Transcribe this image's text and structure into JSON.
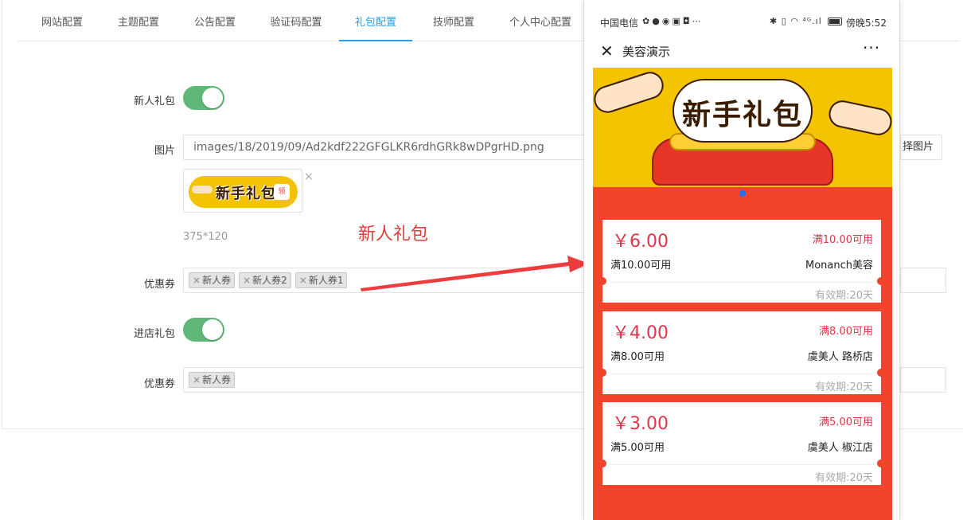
{
  "tabs": [
    "网站配置",
    "主题配置",
    "公告配置",
    "验证码配置",
    "礼包配置",
    "技师配置",
    "个人中心配置"
  ],
  "form": {
    "newbie_label": "新人礼包",
    "image_label": "图片",
    "image_path": "images/18/2019/09/Ad2kdf222GFGLKR6rdhGRk8wDPgrHD.png",
    "pick_image_label": "择图片",
    "thumb_text": "新手礼包",
    "thumb_btn": "领",
    "size_hint": "375*120",
    "annotation": "新人礼包",
    "coupon_label_1": "优惠券",
    "coupons_1": [
      "新人券",
      "新人券2",
      "新人券1"
    ],
    "store_label": "进店礼包",
    "coupon_label_2": "优惠券",
    "coupons_2": [
      "新人券"
    ],
    "tag_remove": "×",
    "thumb_close": "×"
  },
  "phone": {
    "carrier": "中国电信",
    "signal_text": "⁴ᴳ.ıl",
    "time": "傍晚5:52",
    "close": "✕",
    "title": "美容演示",
    "more": "···",
    "banner_title": "新手礼包"
  },
  "coupons": [
    {
      "amount": "￥6.00",
      "cond_right": "满10.00可用",
      "cond_left": "满10.00可用",
      "shop": "Monanch美容",
      "valid": "有效期:20天"
    },
    {
      "amount": "￥4.00",
      "cond_right": "满8.00可用",
      "cond_left": "满8.00可用",
      "shop": "虞美人 路桥店",
      "valid": "有效期:20天"
    },
    {
      "amount": "￥3.00",
      "cond_right": "满5.00可用",
      "cond_left": "满5.00可用",
      "shop": "虞美人 椒江店",
      "valid": "有效期:20天"
    }
  ],
  "colors": {
    "accent": "#1e9fff",
    "switch_on": "#5fb878",
    "coupon_red": "#e0364a",
    "screen_red": "#f2442a",
    "annotation": "#e23c3c"
  }
}
